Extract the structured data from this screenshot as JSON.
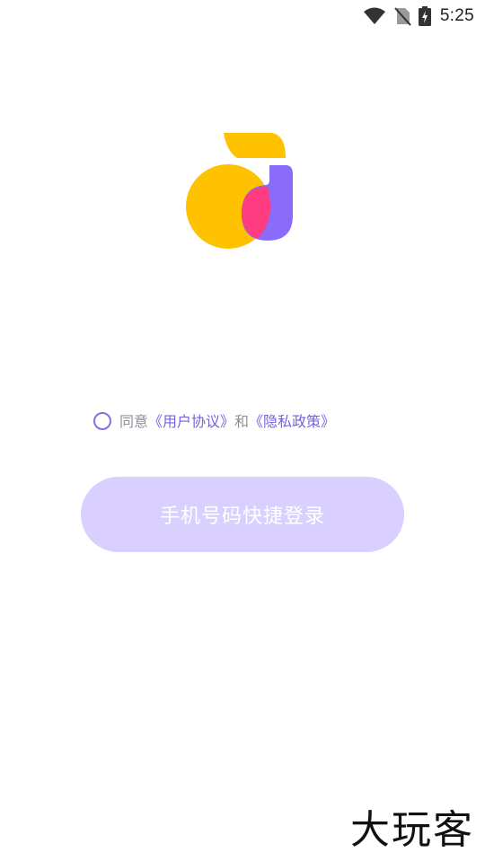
{
  "status_bar": {
    "time": "5:25",
    "icons": [
      "wifi-icon",
      "no-sim-icon",
      "battery-charging-icon"
    ]
  },
  "logo": {
    "icon": "app-logo",
    "colors": [
      "#FFC200",
      "#8B6BFA",
      "#FF3C80"
    ]
  },
  "agreement": {
    "prefix": "同意",
    "user_agreement": "《用户协议》",
    "conjunction": "和",
    "privacy_policy": "《隐私政策》",
    "checked": false
  },
  "login": {
    "button_label": "手机号码快捷登录",
    "accent": "#D9D0FF"
  },
  "watermark": {
    "text": "大玩客"
  }
}
